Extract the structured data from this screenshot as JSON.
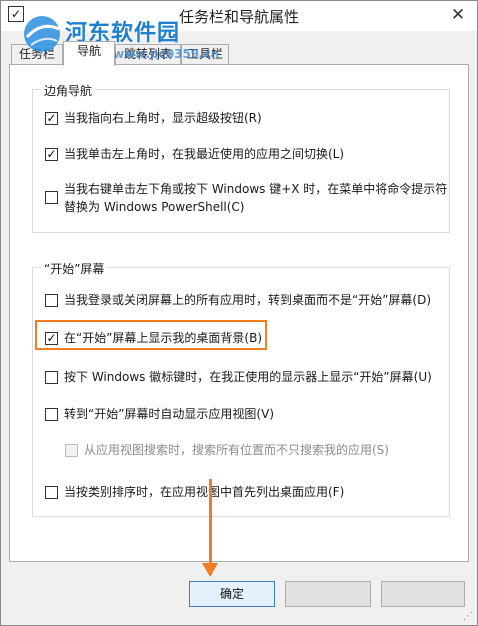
{
  "window": {
    "title": "任务栏和导航属性",
    "title_icon": "✓",
    "close_glyph": "✕"
  },
  "watermark": {
    "text": "河东软件园",
    "url": "www.pc0359.cn"
  },
  "tabs": [
    {
      "label": "任务栏",
      "active": false
    },
    {
      "label": "导航",
      "active": true
    },
    {
      "label": "跳转列表",
      "active": false
    },
    {
      "label": "工具栏",
      "active": false
    }
  ],
  "corner_nav": {
    "title": "边角导航",
    "options": [
      {
        "label": "当我指向右上角时，显示超级按钮(R)",
        "checked": true,
        "mark": "✓"
      },
      {
        "label": "当我单击左上角时，在我最近使用的应用之间切换(L)",
        "checked": true,
        "mark": "✓"
      },
      {
        "label": "当我右键单击左下角或按下 Windows 键+X 时，在菜单中将命令提示符",
        "label2": "替换为 Windows PowerShell(C)",
        "checked": false,
        "mark": ""
      }
    ]
  },
  "start_screen": {
    "title": "“开始”屏幕",
    "options": [
      {
        "label": "当我登录或关闭屏幕上的所有应用时，转到桌面而不是“开始”屏幕(D)",
        "checked": false,
        "mark": ""
      },
      {
        "label": "在“开始”屏幕上显示我的桌面背景(B)",
        "checked": true,
        "mark": "✓"
      },
      {
        "label": "按下 Windows 徽标键时，在我正使用的显示器上显示“开始”屏幕(U)",
        "checked": false,
        "mark": ""
      },
      {
        "label": "转到“开始”屏幕时自动显示应用视图(V)",
        "checked": false,
        "mark": ""
      },
      {
        "label": "从应用视图搜索时，搜索所有位置而不只搜索我的应用(S)",
        "checked": false,
        "disabled": true,
        "mark": ""
      },
      {
        "label": "当按类别排序时，在应用视图中首先列出桌面应用(F)",
        "checked": false,
        "mark": ""
      }
    ]
  },
  "buttons": {
    "ok": "确定",
    "cancel": "",
    "apply": ""
  },
  "colors": {
    "highlight": "#ef7d22",
    "watermark": "#1f7fd1"
  }
}
